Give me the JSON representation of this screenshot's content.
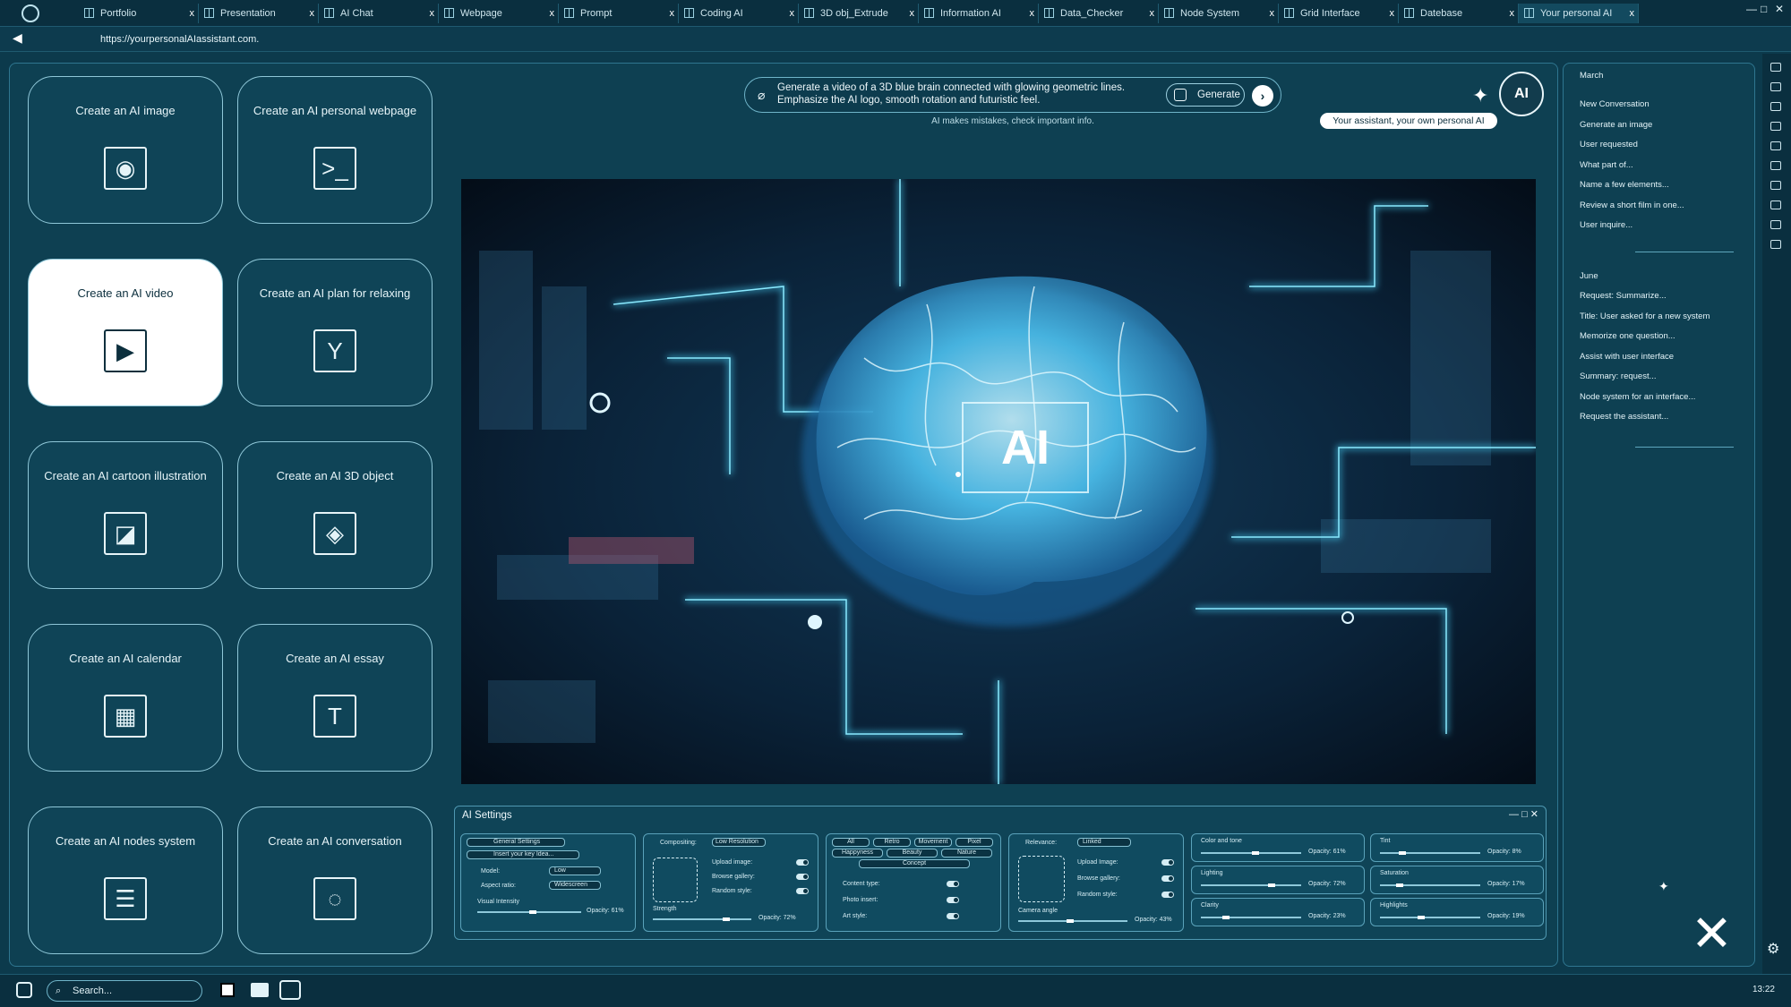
{
  "tabs": [
    {
      "label": "Portfolio",
      "close": "x"
    },
    {
      "label": "Presentation",
      "close": "x"
    },
    {
      "label": "AI Chat",
      "close": "x"
    },
    {
      "label": "Webpage",
      "close": "x"
    },
    {
      "label": "Prompt",
      "close": "x"
    },
    {
      "label": "Coding AI",
      "close": "x"
    },
    {
      "label": "3D obj_Extrude",
      "close": "x"
    },
    {
      "label": "Information AI",
      "close": "x"
    },
    {
      "label": "Data_Checker",
      "close": "x"
    },
    {
      "label": "Node System",
      "close": "x"
    },
    {
      "label": "Grid Interface",
      "close": "x"
    },
    {
      "label": "Datebase",
      "close": "x"
    },
    {
      "label": "Your personal AI",
      "close": "x"
    }
  ],
  "window_controls": {
    "minimize": "—",
    "maximize": "□",
    "close": "✕"
  },
  "address": {
    "url": "https://yourpersonalAIassistant.com."
  },
  "cards": [
    {
      "label": "Create an AI image",
      "icon": "image-icon",
      "glyph": "◉"
    },
    {
      "label": "Create an AI personal webpage",
      "icon": "terminal-icon",
      "glyph": ">_"
    },
    {
      "label": "Create an AI video",
      "icon": "play-icon",
      "glyph": "▶"
    },
    {
      "label": "Create an AI plan for relaxing",
      "icon": "cocktail-icon",
      "glyph": "Y"
    },
    {
      "label": "Create an AI cartoon illustration",
      "icon": "illustration-icon",
      "glyph": "◪"
    },
    {
      "label": "Create an AI 3D object",
      "icon": "cube-icon",
      "glyph": "◈"
    },
    {
      "label": "Create an AI calendar",
      "icon": "calendar-icon",
      "glyph": "▦"
    },
    {
      "label": "Create an AI essay",
      "icon": "text-icon",
      "glyph": "T"
    },
    {
      "label": "Create an AI nodes system",
      "icon": "nodes-icon",
      "glyph": "☰"
    },
    {
      "label": "Create an AI conversation",
      "icon": "conversation-icon",
      "glyph": "◌"
    }
  ],
  "prompt": {
    "text": "Generate a video of a 3D blue brain connected with glowing geometric lines. Emphasize the AI logo, smooth rotation and futuristic feel.",
    "generate": "Generate",
    "send": "›",
    "disclaimer": "AI makes mistakes, check important info."
  },
  "assistant": {
    "avatar": "AI",
    "tagline": "Your assistant, your own personal AI"
  },
  "viewport": {
    "label": "AI"
  },
  "settings": {
    "title": "AI Settings",
    "controls": "— □ ✕",
    "p1": {
      "general": "General Settings",
      "search": "Insert your key Idea...",
      "model_label": "Model:",
      "model": "Low",
      "aspect_label": "Aspect ratio:",
      "aspect": "Widescreen",
      "intensity_label": "Visual Intensity",
      "opacity": "Opacity: 61%"
    },
    "p2": {
      "compositing_label": "Compositing:",
      "compositing": "Low Resolution",
      "upload": "Upload image:",
      "browse": "Browse gallery:",
      "random": "Random style:",
      "strength": "Strength",
      "opacity": "Opacity: 72%"
    },
    "p3": {
      "chips": [
        "All",
        "Retro",
        "Movement",
        "Pixel",
        "Happyness",
        "Beauty",
        "Nature",
        "Concept"
      ],
      "content": "Content type:",
      "photo": "Photo insert:",
      "art": "Art style:"
    },
    "p4": {
      "relevance_label": "Relevance:",
      "relevance": "Linked",
      "upload": "Upload Image:",
      "browse": "Browse gallery:",
      "random": "Random style:",
      "camera": "Camera angle",
      "opacity": "Opacity: 43%"
    },
    "p5": {
      "rows": [
        {
          "label": "Color and tone",
          "value": "Opacity: 61%",
          "level": 0.55
        },
        {
          "label": "Lighting",
          "value": "Opacity: 72%",
          "level": 0.72
        },
        {
          "label": "Clarity",
          "value": "Opacity: 23%",
          "level": 0.23
        }
      ]
    },
    "p6": {
      "rows": [
        {
          "label": "Tint",
          "value": "Opacity: 8%",
          "level": 0.2
        },
        {
          "label": "Saturation",
          "value": "Opacity: 17%",
          "level": 0.17
        },
        {
          "label": "Highlights",
          "value": "Opacity: 19%",
          "level": 0.4
        }
      ]
    }
  },
  "history": {
    "month1": "March",
    "items1": [
      "New Conversation",
      "Generate an image",
      "User requested",
      "What part of...",
      "Name a few elements...",
      "Review a short film in one...",
      "User inquire..."
    ],
    "month2": "June",
    "items2": [
      "Request: Summarize...",
      "Title: User asked for a new system",
      "Memorize one question...",
      "Assist with user interface",
      "Summary: request...",
      "Node system for an interface...",
      "Request the assistant..."
    ]
  },
  "taskbar": {
    "search": "Search...",
    "time": "13:22"
  },
  "colors": {
    "background": "#0c3a4c",
    "panel": "#0e4052",
    "accent": "#8fc7d8",
    "glow": "#5fd8ff"
  }
}
